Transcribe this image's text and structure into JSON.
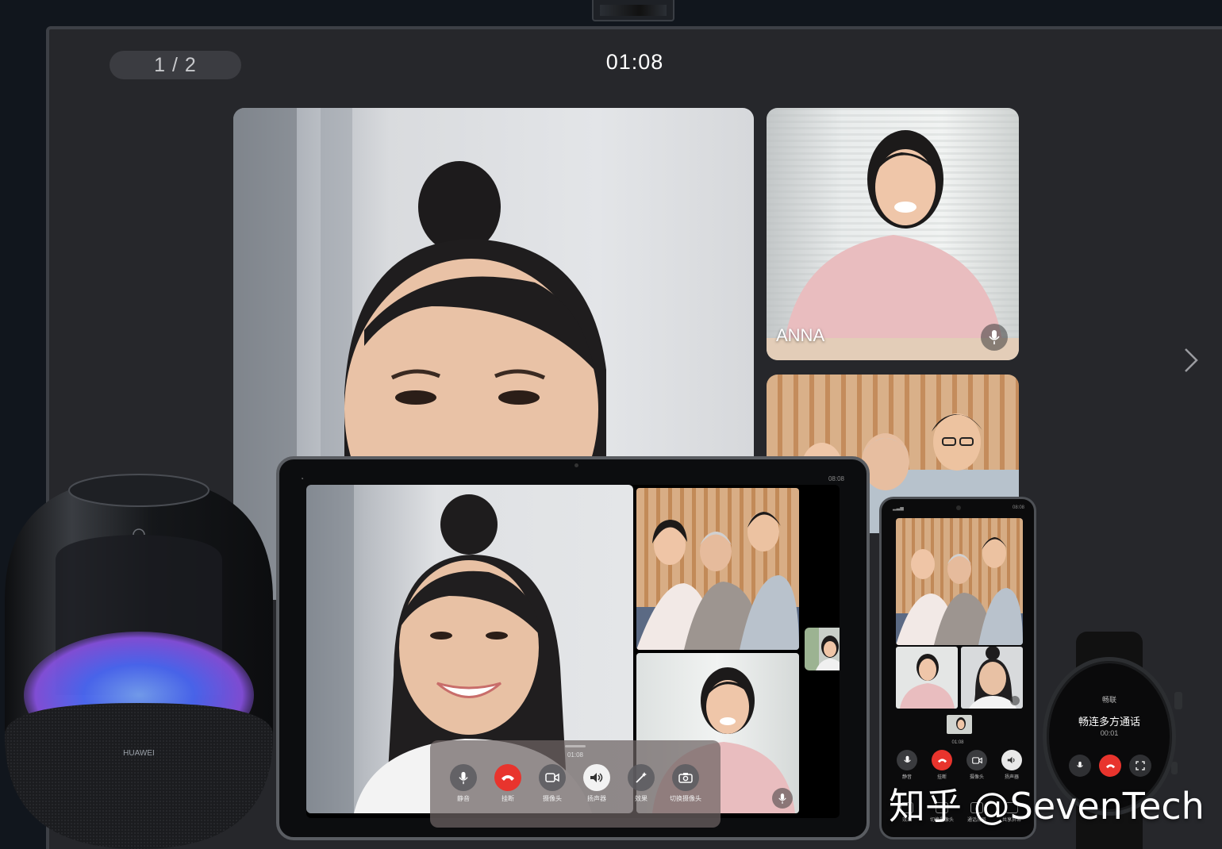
{
  "tv": {
    "page_indicator": "1 / 2",
    "call_timer": "01:08",
    "participant_name": "ANNA"
  },
  "tablet": {
    "panel_time": "01:08",
    "status_time": "08:08",
    "controls": [
      {
        "label": "静音",
        "icon": "microphone-icon"
      },
      {
        "label": "挂断",
        "icon": "hangup-icon"
      },
      {
        "label": "摄像头",
        "icon": "camera-icon"
      },
      {
        "label": "扬声器",
        "icon": "speaker-icon"
      },
      {
        "label": "效果",
        "icon": "effects-icon"
      },
      {
        "label": "切换摄像头",
        "icon": "switch-camera-icon"
      }
    ]
  },
  "phone": {
    "status_time": "08:08",
    "call_time": "01:08",
    "controls_top": [
      {
        "label": "静音",
        "icon": "microphone-icon"
      },
      {
        "label": "挂断",
        "icon": "hangup-icon"
      },
      {
        "label": "摄像头",
        "icon": "camera-icon"
      },
      {
        "label": "扬声器",
        "icon": "speaker-icon"
      }
    ],
    "controls_bottom": [
      {
        "label": "效果",
        "icon": "effects-icon"
      },
      {
        "label": "切换摄像头",
        "icon": "switch-camera-icon"
      },
      {
        "label": "通话成员",
        "icon": "members-icon"
      },
      {
        "label": "共享屏幕",
        "icon": "share-screen-icon"
      }
    ]
  },
  "watch": {
    "status": "畅联",
    "title": "畅连多方通话",
    "time": "00:01"
  },
  "speaker": {
    "brand": "HUAWEI"
  },
  "watermark": "知乎 @SevenTech",
  "colors": {
    "hangup_red": "#e8342d",
    "tv_bezel": "#3d4046",
    "background": "#11161d"
  }
}
